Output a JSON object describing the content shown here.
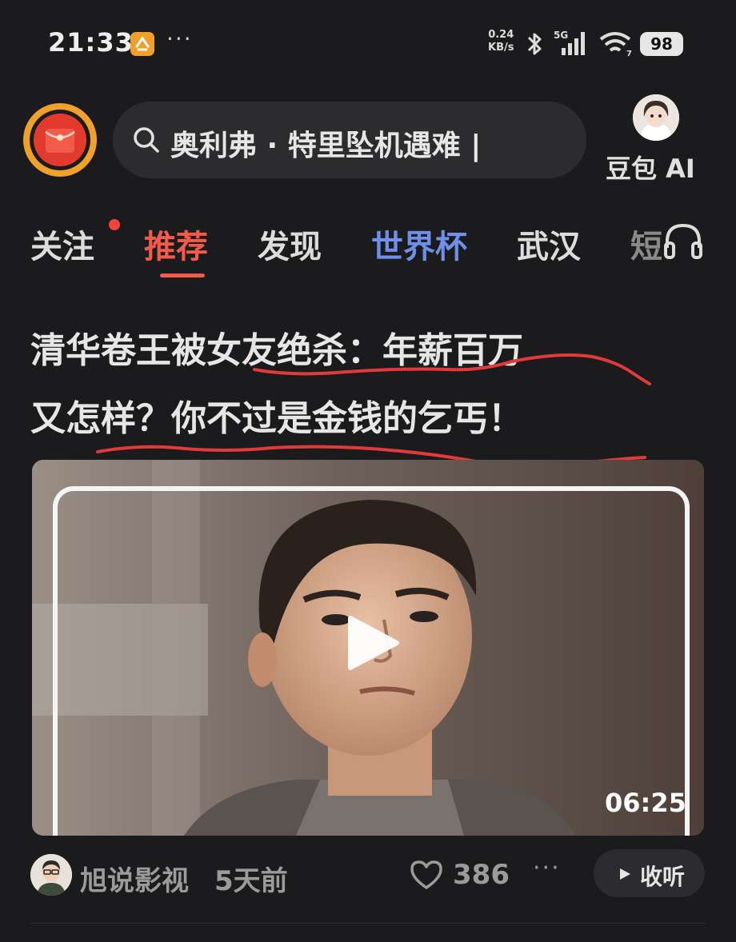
{
  "status_bar": {
    "time": "21:33",
    "more_dots": "···",
    "net_speed_value": "0.24",
    "net_speed_unit": "KB/s",
    "network": "5G",
    "battery": "98"
  },
  "header": {
    "search_text": "奥利弗 · 特里坠机遇难 |",
    "ai_label": "豆包 AI"
  },
  "tabs": [
    {
      "label": "关注",
      "has_dot": true
    },
    {
      "label": "推荐",
      "active": true
    },
    {
      "label": "发现"
    },
    {
      "label": "世界杯"
    },
    {
      "label": "武汉"
    },
    {
      "label": "短"
    }
  ],
  "article": {
    "headline_line1": "清华卷王被女友绝杀：年薪百万",
    "headline_line2": "又怎样？你不过是金钱的乞丐！",
    "video_duration": "06:25",
    "author": "旭说影视",
    "posted": "5天前",
    "likes": "386",
    "more": "···",
    "listen_label": "收听"
  },
  "colors": {
    "background": "#1b1b1d",
    "accent_red": "#f25a4a",
    "worldcup_blue": "#6f8fe8",
    "search_bg": "#2c2c2f",
    "annotation_red": "#e03a3a"
  }
}
